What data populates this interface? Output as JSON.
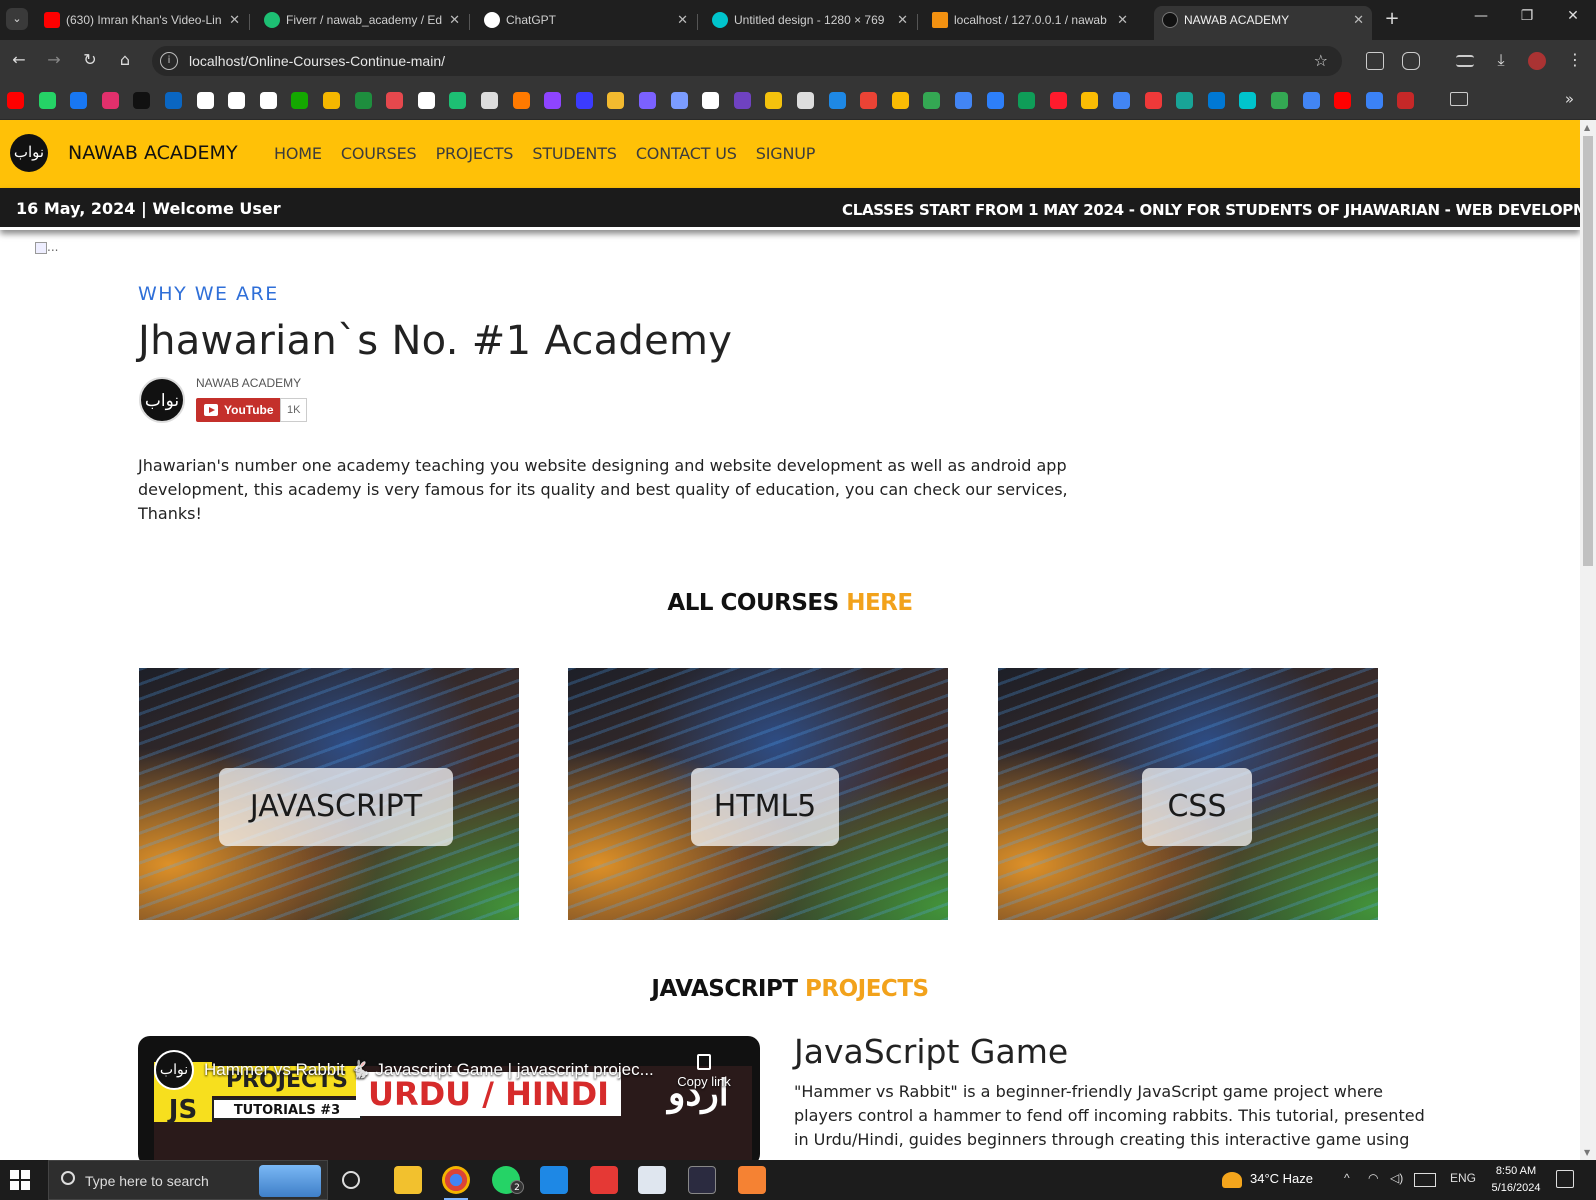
{
  "browser": {
    "tabs": [
      {
        "label": "(630) Imran Khan's Video-Lin",
        "favicon": "youtube-icon",
        "color": "#ff0000"
      },
      {
        "label": "Fiverr / nawab_academy / Ed",
        "favicon": "fiverr-icon",
        "color": "#1dbf73"
      },
      {
        "label": "ChatGPT",
        "favicon": "chatgpt-icon",
        "color": "#ffffff"
      },
      {
        "label": "Untitled design - 1280 × 769",
        "favicon": "canva-icon",
        "color": "#00c4cc"
      },
      {
        "label": "localhost / 127.0.0.1 / nawab",
        "favicon": "phpmyadmin-icon",
        "color": "#f29111"
      },
      {
        "label": "NAWAB ACADEMY",
        "favicon": "nawab-icon",
        "color": "#111111"
      }
    ],
    "new_tab_label": "+",
    "url": "localhost/Online-Courses-Continue-main/",
    "bookmark_icons": [
      "youtube",
      "whatsapp",
      "facebook",
      "instagram",
      "tiktok",
      "linkedin",
      "github",
      "chatgpt",
      "x",
      "upwork",
      "bee",
      "tool",
      "76",
      "openai",
      "fiverr",
      "globe",
      "fire",
      "u",
      "w",
      "binance",
      "h",
      "infinity",
      "a",
      "k",
      "bee2",
      "globe2",
      "d",
      "gmail",
      "photos",
      "drive",
      "ads",
      "flag",
      "sheet",
      "opera",
      "keep",
      "translate",
      "vivaldi",
      "photopea",
      "vscode",
      "canva",
      "tuts",
      "docs",
      "adobe",
      "diamond",
      "red"
    ],
    "bookmark_colors": [
      "#ff0000",
      "#25d366",
      "#1877f2",
      "#e1306c",
      "#111111",
      "#0a66c2",
      "#ffffff",
      "#ffffff",
      "#ffffff",
      "#14a800",
      "#f5b700",
      "#1e8e3e",
      "#e5484d",
      "#ffffff",
      "#1dbf73",
      "#dddddd",
      "#ff7a00",
      "#8e44ff",
      "#3b3bff",
      "#f3ba2f",
      "#7b61ff",
      "#7b9cff",
      "#ffffff",
      "#6f42c1",
      "#f4c20d",
      "#dddddd",
      "#1e88e5",
      "#ea4335",
      "#fbbc04",
      "#34a853",
      "#4285f4",
      "#2d7ff9",
      "#0f9d58",
      "#ff1b2d",
      "#fbbc04",
      "#4285f4",
      "#ef3939",
      "#18a497",
      "#0078d4",
      "#00c4cc",
      "#34a853",
      "#4285f4",
      "#ff0000",
      "#3b82f6",
      "#c62828"
    ]
  },
  "site": {
    "brand": "NAWAB ACADEMY",
    "logo_glyph": "نواب",
    "nav": [
      "HOME",
      "COURSES",
      "PROJECTS",
      "STUDENTS",
      "CONTACT US",
      "SIGNUP"
    ],
    "accent": "#ffc107",
    "news_date": "16 May, 2024 | Welcome User",
    "news_ticker": "CLASSES START FROM 1 MAY 2024 - ONLY FOR STUDENTS OF JHAWARIAN - WEB DEVELOPMENT &"
  },
  "hero": {
    "broken_image_alt": "...",
    "eyebrow": "WHY WE ARE",
    "title": "Jhawarian`s No. #1 Academy",
    "channel_name": "NAWAB ACADEMY",
    "youtube_label": "YouTube",
    "subscriber_count": "1K",
    "description": "Jhawarian's number one academy teaching you website designing and website development as well as android app development, this academy is very famous for its quality and best quality of education, you can check our services, Thanks!"
  },
  "courses": {
    "title_main": "ALL COURSES",
    "title_highlight": "HERE",
    "highlight_color": "#f2a21b",
    "items": [
      "JAVASCRIPT",
      "HTML5",
      "CSS"
    ]
  },
  "projects": {
    "title_main": "JAVASCRIPT",
    "title_highlight": "PROJECTS",
    "video": {
      "title": "Hammer vs Rabbit 🐇 Javascript Game | javascript projec...",
      "copy_label": "Copy link",
      "thumb_js": "JS",
      "thumb_projects": "PROJECTS",
      "thumb_tutorial": "TUTORIALS #3",
      "thumb_lang": "URDU / HINDI",
      "thumb_urdu": "اردو"
    },
    "game_title": "JavaScript Game",
    "game_text": "\"Hammer vs Rabbit\" is a beginner-friendly JavaScript game project where players control a hammer to fend off incoming rabbits. This tutorial, presented in Urdu/Hindi, guides beginners through creating this interactive game using"
  },
  "taskbar": {
    "search_placeholder": "Type here to search",
    "whatsapp_badge": "2",
    "weather": "34°C  Haze",
    "language": "ENG",
    "time": "8:50 AM",
    "date": "5/16/2024"
  }
}
